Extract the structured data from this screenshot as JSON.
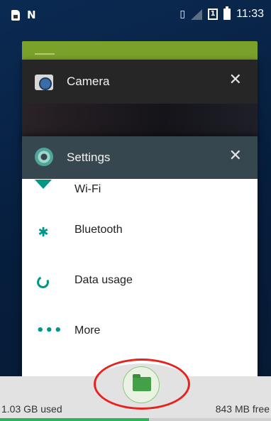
{
  "status_bar": {
    "time": "11:33",
    "sim_badge": "1",
    "icons": [
      "sim-icon",
      "n-icon",
      "vibrate-icon",
      "signal-icon",
      "sim1-icon",
      "battery-icon"
    ]
  },
  "recents": {
    "camera": {
      "title": "Camera",
      "close": "✕",
      "icon": "camera-icon"
    },
    "settings": {
      "title": "Settings",
      "close": "✕",
      "icon": "gear-icon",
      "items": [
        {
          "label": "Wi-Fi",
          "icon": "wifi-icon"
        },
        {
          "label": "Bluetooth",
          "icon": "bluetooth-icon"
        },
        {
          "label": "Data usage",
          "icon": "data-usage-icon"
        },
        {
          "label": "More",
          "icon": "more-icon"
        }
      ]
    }
  },
  "storage": {
    "used_label": "1.03 GB used",
    "free_label": "843 MB free",
    "used_fraction": 0.55
  },
  "colors": {
    "accent": "#009688",
    "highlight": "#e52320",
    "progress": "#2db35a"
  }
}
